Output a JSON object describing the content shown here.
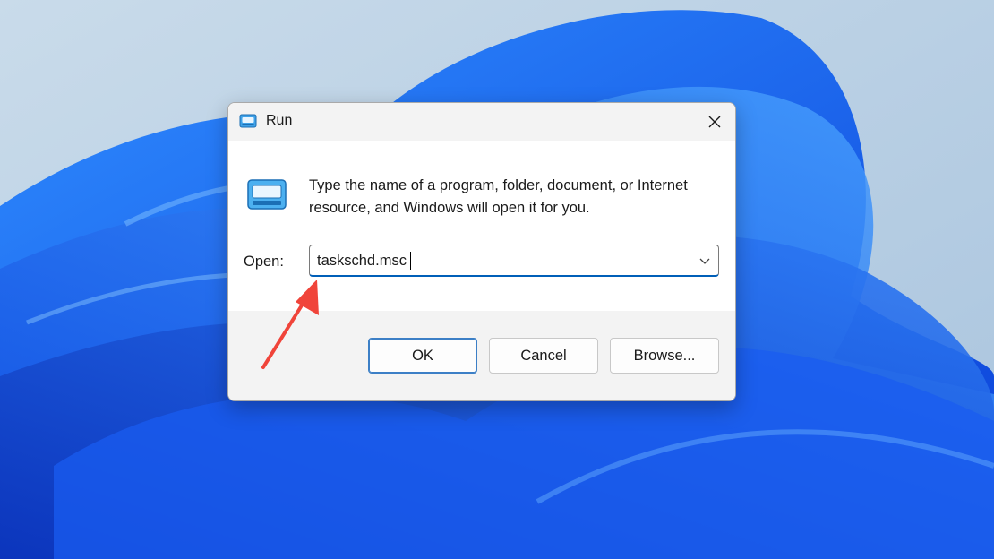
{
  "dialog": {
    "title": "Run",
    "description": "Type the name of a program, folder, document, or Internet resource, and Windows will open it for you.",
    "open_label": "Open:",
    "open_value": "taskschd.msc",
    "buttons": {
      "ok": "OK",
      "cancel": "Cancel",
      "browse": "Browse..."
    }
  },
  "icons": {
    "title": "run-app-icon",
    "main": "run-app-icon",
    "close": "close-icon",
    "dropdown": "chevron-down-icon"
  },
  "colors": {
    "accent": "#005fb8",
    "annotation_arrow": "#f0443a",
    "titlebar": "#f3f3f3",
    "footer": "#f3f3f3"
  }
}
